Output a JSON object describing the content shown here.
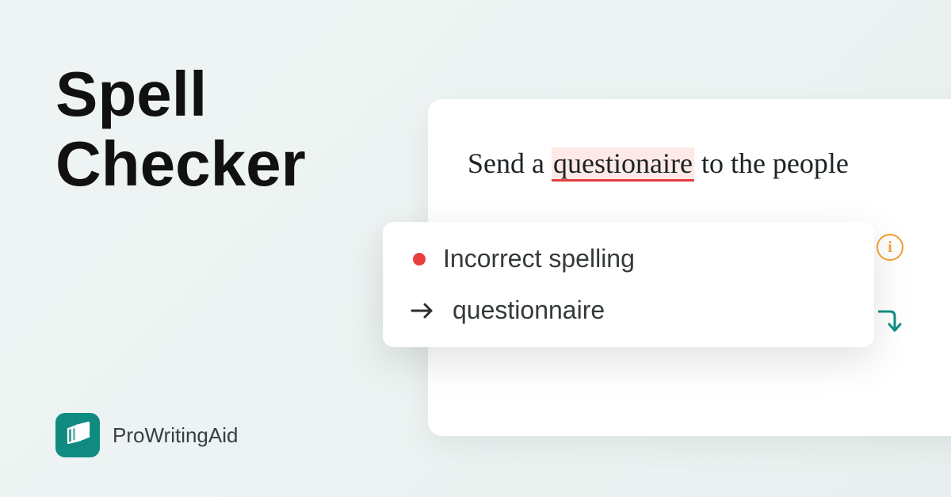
{
  "title_line1": "Spell",
  "title_line2": "Checker",
  "brand": {
    "name": "ProWritingAid"
  },
  "editor": {
    "text_before": "Send a ",
    "misspelled_word": "questionaire",
    "text_after": " to the people"
  },
  "suggestion": {
    "issue_label": "Incorrect spelling",
    "correction": "questionnaire"
  },
  "colors": {
    "teal": "#0f8b82",
    "error": "#e93e3e",
    "accent_orange": "#f29c2b"
  }
}
